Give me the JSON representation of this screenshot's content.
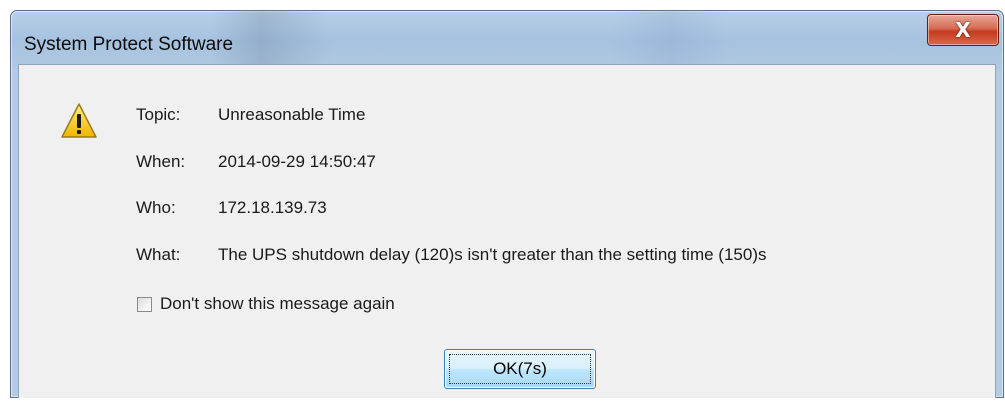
{
  "window": {
    "title": "System Protect Software",
    "close_label": "X"
  },
  "message": {
    "icon": "warning-icon",
    "topic_label": "Topic:",
    "topic_value": "Unreasonable Time",
    "when_label": "When:",
    "when_value": "2014-09-29 14:50:47",
    "who_label": "Who:",
    "who_value": "172.18.139.73",
    "what_label": "What:",
    "what_value": "The UPS shutdown delay (120)s isn't greater than the setting time (150)s"
  },
  "checkbox": {
    "label": "Don't show this message again",
    "checked": false
  },
  "ok_button": {
    "label": "OK(7s)"
  },
  "colors": {
    "close_red": "#c33b1e",
    "ok_blue": "#bee6fd",
    "warning_yellow": "#f5c400"
  }
}
